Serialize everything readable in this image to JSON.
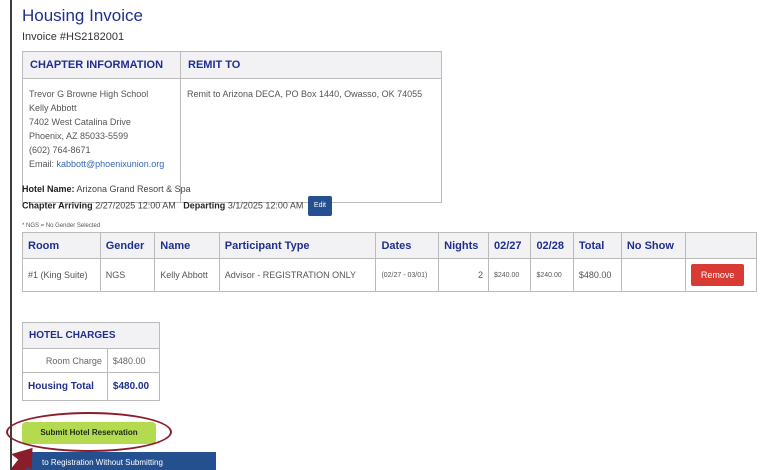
{
  "header": {
    "title": "Housing Invoice",
    "invoice_number": "Invoice #HS2182001"
  },
  "chapter_table": {
    "col1_header": "CHAPTER INFORMATION",
    "col2_header": "REMIT TO",
    "chapter_lines": [
      "Trevor G Browne High School",
      "Kelly Abbott",
      "7402 West Catalina Drive",
      "Phoenix, AZ 85033-5599",
      "(602) 764-8671"
    ],
    "email_label": "Email: ",
    "email": "kabbott@phoenixunion.org",
    "remit_to": "Remit to Arizona DECA, PO Box 1440, Owasso, OK 74055"
  },
  "hotel": {
    "name_label": "Hotel Name:",
    "name": "Arizona Grand Resort & Spa",
    "arriving_label": "Chapter Arriving",
    "arriving": "2/27/2025 12:00 AM",
    "departing_label": "Departing",
    "departing": "3/1/2025 12:00 AM",
    "edit_label": "Edit"
  },
  "ngs_note": "* NGS = No Gender Selected",
  "room_table": {
    "headers": [
      "Room",
      "Gender",
      "Name",
      "Participant Type",
      "Dates",
      "Nights",
      "02/27",
      "02/28",
      "Total",
      "No Show",
      ""
    ],
    "rows": [
      {
        "room": "#1 (King Suite)",
        "gender": "NGS",
        "name": "Kelly Abbott",
        "participant_type": "Advisor - REGISTRATION ONLY",
        "dates": "(02/27 - 03/01)",
        "nights": "2",
        "night1": "$240.00",
        "night2": "$240.00",
        "total": "$480.00",
        "no_show": "",
        "remove_label": "Remove"
      }
    ]
  },
  "charges": {
    "header": "HOTEL CHARGES",
    "room_charge_label": "Room Charge",
    "room_charge": "$480.00",
    "total_label": "Housing Total",
    "total": "$480.00"
  },
  "actions": {
    "submit_label": "Submit Hotel Reservation",
    "back_label": "to Registration Without Submitting"
  },
  "colors": {
    "heading": "#1f2f8f",
    "submit": "#b4da50",
    "primary_button": "#25508f",
    "remove_button": "#d93a34",
    "annotation": "#8b1d2a"
  }
}
